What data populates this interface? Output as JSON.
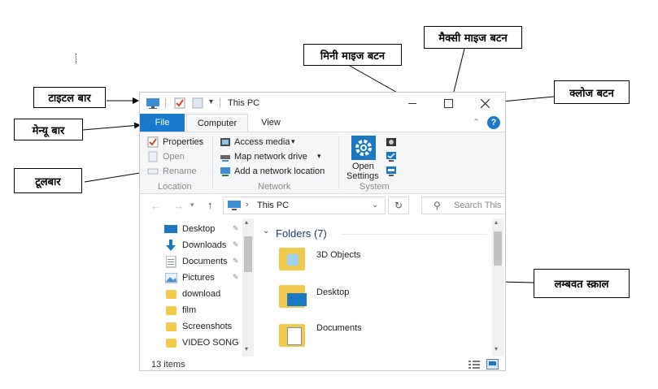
{
  "callouts": {
    "title_bar": "टाइटल बार",
    "menu_bar": "मेन्यू बार",
    "toolbar": "टूलबार",
    "minimize": "मिनी माइज बटन",
    "maximize": "मैक्सी माइज बटन",
    "close": "क्लोज बटन",
    "vscroll": "लम्बवत स्क्राल"
  },
  "window": {
    "title": "This PC",
    "tabs": {
      "file": "File",
      "computer": "Computer",
      "view": "View"
    },
    "ribbon": {
      "location": {
        "properties": "Properties",
        "open": "Open",
        "rename": "Rename",
        "group": "Location"
      },
      "network": {
        "access_media": "Access media",
        "map_drive": "Map network drive",
        "add_location": "Add a network location",
        "group": "Network"
      },
      "system": {
        "open_settings_1": "Open",
        "open_settings_2": "Settings",
        "group": "System"
      }
    },
    "address": {
      "path": "This PC",
      "search_placeholder": "Search This"
    },
    "sidebar": {
      "items": [
        {
          "label": "Desktop"
        },
        {
          "label": "Downloads"
        },
        {
          "label": "Documents"
        },
        {
          "label": "Pictures"
        },
        {
          "label": "download"
        },
        {
          "label": "film"
        },
        {
          "label": "Screenshots"
        },
        {
          "label": "VIDEO SONG"
        }
      ]
    },
    "content": {
      "section": "Folders (7)",
      "folders": [
        {
          "label": "3D Objects"
        },
        {
          "label": "Desktop"
        },
        {
          "label": "Documents"
        }
      ]
    },
    "status": {
      "items": "13 items"
    }
  },
  "colors": {
    "accent": "#1979ca",
    "folder": "#f2c94c",
    "settings": "#1a78c2"
  }
}
